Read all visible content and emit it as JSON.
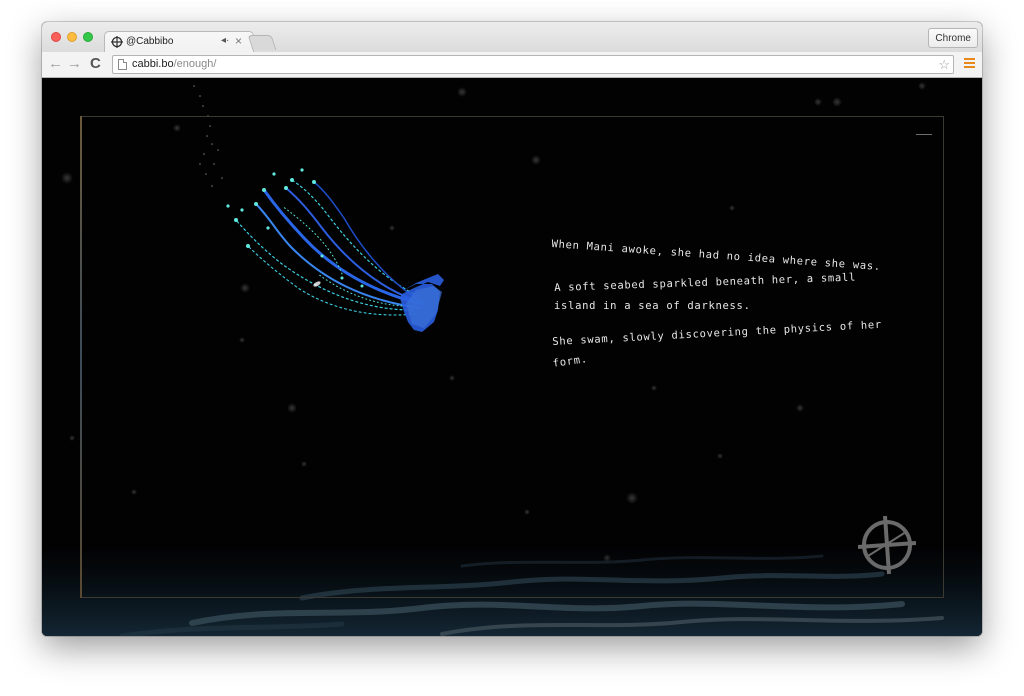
{
  "tab": {
    "title": "@Cabbibo",
    "audio_icon": "◂·",
    "close": "×"
  },
  "profile_button": "Chrome",
  "address": {
    "host": "cabbi.bo",
    "path": "/enough/"
  },
  "icons": {
    "tab_favicon": "crosshair-circle-icon",
    "back": "back-arrow-icon",
    "forward": "forward-arrow-icon",
    "reload": "reload-icon",
    "page": "page-icon",
    "bookmark": "star-icon",
    "menu": "hamburger-menu-icon",
    "scene_crosshair": "crosshair-circle-icon"
  },
  "nav_glyphs": {
    "back": "←",
    "forward": "→",
    "reload": "C",
    "star": "☆"
  },
  "story": {
    "line1": "When Mani awoke, she had no idea where she was.",
    "line2": "A soft seabed sparkled beneath her, a small",
    "line3": "island in a sea of darkness.",
    "line4": "She swam, slowly discovering the physics of her",
    "line5": "form."
  },
  "colors": {
    "background": "#020203",
    "text": "#e8e8e8",
    "creature_body": "#2a5ee0",
    "creature_tentacles": "#3ad0e0",
    "menu_accent": "#e8891c"
  }
}
